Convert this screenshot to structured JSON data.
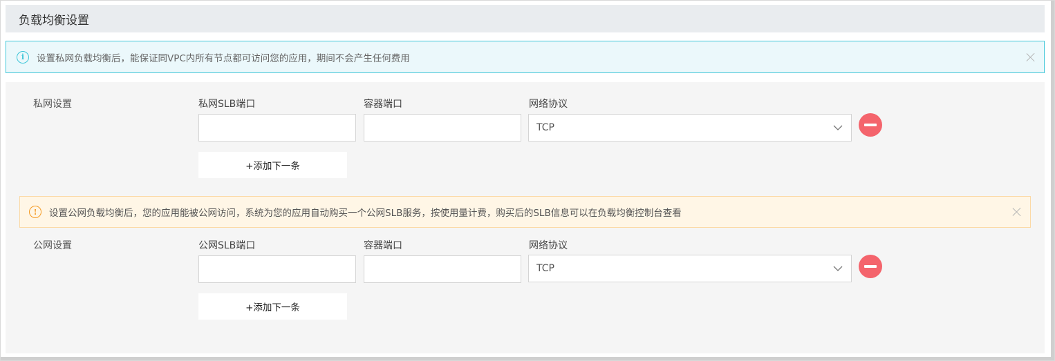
{
  "section": {
    "title": "负载均衡设置"
  },
  "info_alert": {
    "icon": "info-circle-icon",
    "text": "设置私网负载均衡后，能保证同VPC内所有节点都可访问您的应用，期间不会产生任何费用",
    "color": "#3ec6d8"
  },
  "private": {
    "row_label": "私网设置",
    "slb_port_label": "私网SLB端口",
    "container_port_label": "容器端口",
    "protocol_label": "网络协议",
    "slb_port_value": "",
    "container_port_value": "",
    "protocol_value": "TCP",
    "add_label": "+添加下一条"
  },
  "warn_alert": {
    "icon": "warning-circle-icon",
    "text": "设置公网负载均衡后，您的应用能被公网访问，系统为您的应用自动购买一个公网SLB服务，按使用量计费，购买后的SLB信息可以在负载均衡控制台查看",
    "color": "#f59a23"
  },
  "public": {
    "row_label": "公网设置",
    "slb_port_label": "公网SLB端口",
    "container_port_label": "容器端口",
    "protocol_label": "网络协议",
    "slb_port_value": "",
    "container_port_value": "",
    "protocol_value": "TCP",
    "add_label": "+添加下一条"
  },
  "colors": {
    "remove_button": "#f4646c",
    "header_bg": "#e9ecef",
    "panel_bg": "#f5f5f5"
  }
}
